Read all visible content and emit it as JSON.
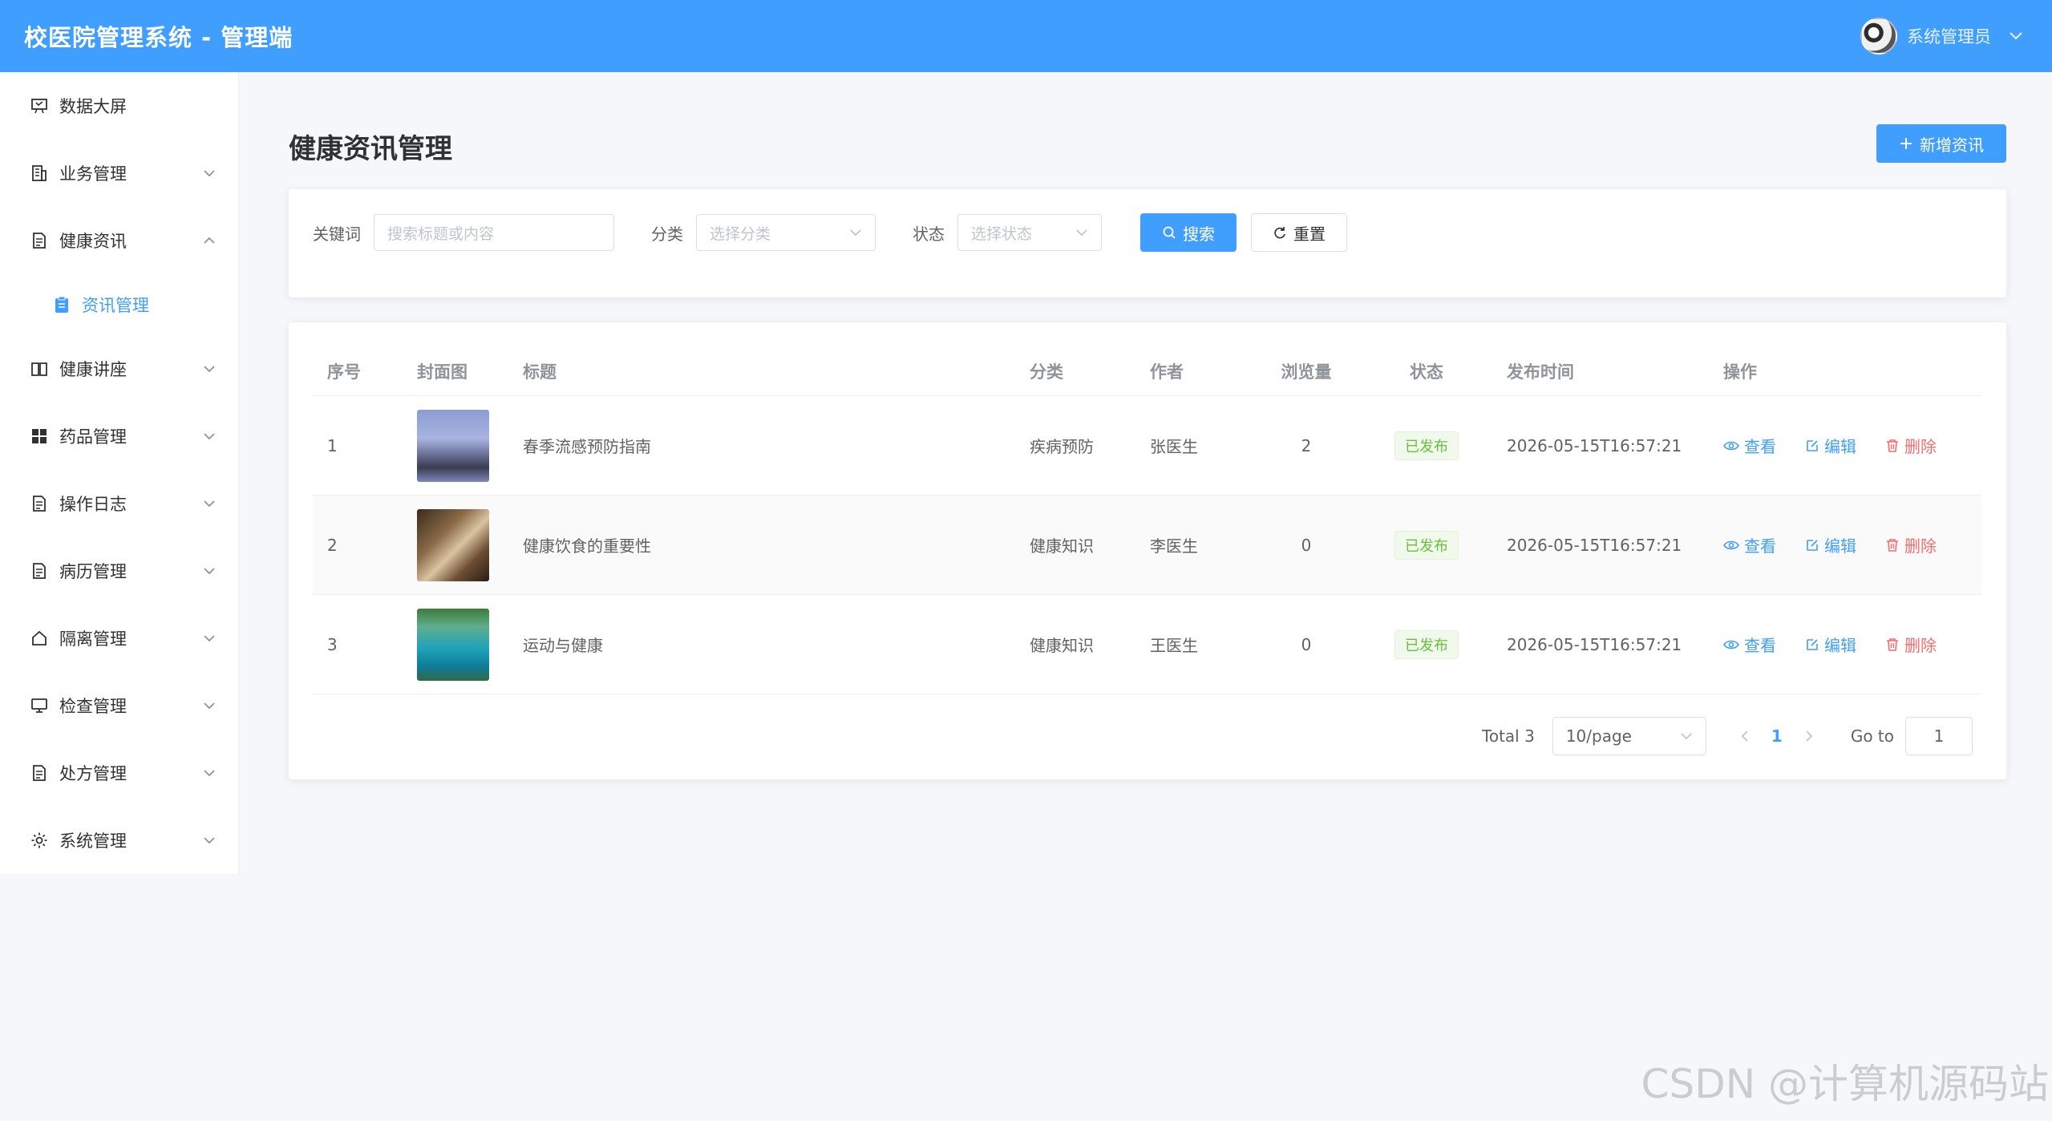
{
  "header": {
    "title": "校医院管理系统 - 管理端",
    "user_name": "系统管理员"
  },
  "sidebar": {
    "items": [
      {
        "label": "数据大屏",
        "icon": "dashboard-icon",
        "caret": ""
      },
      {
        "label": "业务管理",
        "icon": "building-icon",
        "caret": "⌄"
      },
      {
        "label": "健康资讯",
        "icon": "document-icon",
        "caret": "⌃"
      },
      {
        "label": "资讯管理",
        "icon": "clipboard-icon",
        "sub": true
      },
      {
        "label": "健康讲座",
        "icon": "book-icon",
        "caret": "⌄"
      },
      {
        "label": "药品管理",
        "icon": "grid-icon",
        "caret": "⌄"
      },
      {
        "label": "操作日志",
        "icon": "document-icon",
        "caret": "⌄"
      },
      {
        "label": "病历管理",
        "icon": "document-icon",
        "caret": "⌄"
      },
      {
        "label": "隔离管理",
        "icon": "house-icon",
        "caret": "⌄"
      },
      {
        "label": "检查管理",
        "icon": "monitor-icon",
        "caret": "⌄"
      },
      {
        "label": "处方管理",
        "icon": "document-icon",
        "caret": "⌄"
      },
      {
        "label": "系统管理",
        "icon": "gear-icon",
        "caret": "⌄"
      }
    ]
  },
  "main": {
    "page_title": "健康资讯管理",
    "add_button": "新增资讯"
  },
  "filter": {
    "keyword_label": "关键词",
    "keyword_placeholder": "搜索标题或内容",
    "category_label": "分类",
    "category_placeholder": "选择分类",
    "status_label": "状态",
    "status_placeholder": "选择状态",
    "search_button": "搜索",
    "reset_button": "重置"
  },
  "table": {
    "columns": [
      "序号",
      "封面图",
      "标题",
      "分类",
      "作者",
      "浏览量",
      "状态",
      "发布时间",
      "操作"
    ],
    "rows": [
      {
        "index": "1",
        "title": "春季流感预防指南",
        "category": "疾病预防",
        "author": "张医生",
        "views": "2",
        "status": "已发布",
        "time": "2026-05-15T16:57:21"
      },
      {
        "index": "2",
        "title": "健康饮食的重要性",
        "category": "健康知识",
        "author": "李医生",
        "views": "0",
        "status": "已发布",
        "time": "2026-05-15T16:57:21"
      },
      {
        "index": "3",
        "title": "运动与健康",
        "category": "健康知识",
        "author": "王医生",
        "views": "0",
        "status": "已发布",
        "time": "2026-05-15T16:57:21"
      }
    ],
    "ops": {
      "view": "查看",
      "edit": "编辑",
      "delete": "删除"
    }
  },
  "pagination": {
    "total": "Total 3",
    "page_size": "10/page",
    "current_page": "1",
    "goto_label": "Go to",
    "goto_value": "1"
  },
  "watermark": "CSDN @计算机源码站",
  "colors": {
    "primary": "#409eff",
    "success": "#67c23a",
    "danger": "#f56c6c"
  }
}
